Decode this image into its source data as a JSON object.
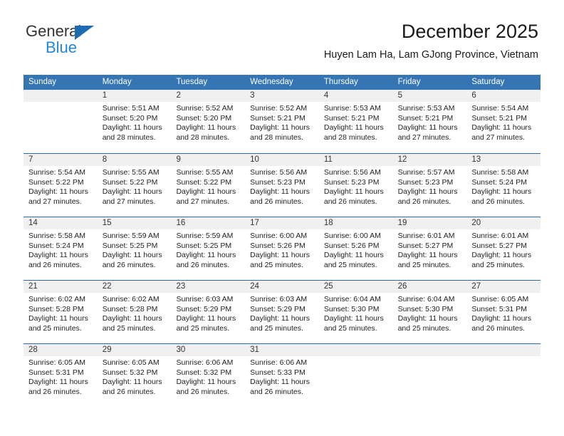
{
  "logo": {
    "word_top": "General",
    "word_bottom": "Blue",
    "triangle_icon": "triangle-icon",
    "colors": {
      "blue": "#2287d6",
      "triangle": "#1b6cb0",
      "dark": "#333333"
    }
  },
  "header": {
    "title": "December 2025",
    "subtitle": "Huyen Lam Ha, Lam GJong Province, Vietnam"
  },
  "theme": {
    "header_bar": "#3575b3",
    "row_divider": "#2f6aa8",
    "daynum_band": "#f0f0f0"
  },
  "weekdays": [
    "Sunday",
    "Monday",
    "Tuesday",
    "Wednesday",
    "Thursday",
    "Friday",
    "Saturday"
  ],
  "weeks": [
    {
      "days": [
        {
          "num": "",
          "lines": []
        },
        {
          "num": "1",
          "lines": [
            "Sunrise: 5:51 AM",
            "Sunset: 5:20 PM",
            "Daylight: 11 hours",
            "and 28 minutes."
          ]
        },
        {
          "num": "2",
          "lines": [
            "Sunrise: 5:52 AM",
            "Sunset: 5:20 PM",
            "Daylight: 11 hours",
            "and 28 minutes."
          ]
        },
        {
          "num": "3",
          "lines": [
            "Sunrise: 5:52 AM",
            "Sunset: 5:21 PM",
            "Daylight: 11 hours",
            "and 28 minutes."
          ]
        },
        {
          "num": "4",
          "lines": [
            "Sunrise: 5:53 AM",
            "Sunset: 5:21 PM",
            "Daylight: 11 hours",
            "and 28 minutes."
          ]
        },
        {
          "num": "5",
          "lines": [
            "Sunrise: 5:53 AM",
            "Sunset: 5:21 PM",
            "Daylight: 11 hours",
            "and 27 minutes."
          ]
        },
        {
          "num": "6",
          "lines": [
            "Sunrise: 5:54 AM",
            "Sunset: 5:21 PM",
            "Daylight: 11 hours",
            "and 27 minutes."
          ]
        }
      ]
    },
    {
      "days": [
        {
          "num": "7",
          "lines": [
            "Sunrise: 5:54 AM",
            "Sunset: 5:22 PM",
            "Daylight: 11 hours",
            "and 27 minutes."
          ]
        },
        {
          "num": "8",
          "lines": [
            "Sunrise: 5:55 AM",
            "Sunset: 5:22 PM",
            "Daylight: 11 hours",
            "and 27 minutes."
          ]
        },
        {
          "num": "9",
          "lines": [
            "Sunrise: 5:55 AM",
            "Sunset: 5:22 PM",
            "Daylight: 11 hours",
            "and 27 minutes."
          ]
        },
        {
          "num": "10",
          "lines": [
            "Sunrise: 5:56 AM",
            "Sunset: 5:23 PM",
            "Daylight: 11 hours",
            "and 26 minutes."
          ]
        },
        {
          "num": "11",
          "lines": [
            "Sunrise: 5:56 AM",
            "Sunset: 5:23 PM",
            "Daylight: 11 hours",
            "and 26 minutes."
          ]
        },
        {
          "num": "12",
          "lines": [
            "Sunrise: 5:57 AM",
            "Sunset: 5:23 PM",
            "Daylight: 11 hours",
            "and 26 minutes."
          ]
        },
        {
          "num": "13",
          "lines": [
            "Sunrise: 5:58 AM",
            "Sunset: 5:24 PM",
            "Daylight: 11 hours",
            "and 26 minutes."
          ]
        }
      ]
    },
    {
      "days": [
        {
          "num": "14",
          "lines": [
            "Sunrise: 5:58 AM",
            "Sunset: 5:24 PM",
            "Daylight: 11 hours",
            "and 26 minutes."
          ]
        },
        {
          "num": "15",
          "lines": [
            "Sunrise: 5:59 AM",
            "Sunset: 5:25 PM",
            "Daylight: 11 hours",
            "and 26 minutes."
          ]
        },
        {
          "num": "16",
          "lines": [
            "Sunrise: 5:59 AM",
            "Sunset: 5:25 PM",
            "Daylight: 11 hours",
            "and 26 minutes."
          ]
        },
        {
          "num": "17",
          "lines": [
            "Sunrise: 6:00 AM",
            "Sunset: 5:26 PM",
            "Daylight: 11 hours",
            "and 25 minutes."
          ]
        },
        {
          "num": "18",
          "lines": [
            "Sunrise: 6:00 AM",
            "Sunset: 5:26 PM",
            "Daylight: 11 hours",
            "and 25 minutes."
          ]
        },
        {
          "num": "19",
          "lines": [
            "Sunrise: 6:01 AM",
            "Sunset: 5:27 PM",
            "Daylight: 11 hours",
            "and 25 minutes."
          ]
        },
        {
          "num": "20",
          "lines": [
            "Sunrise: 6:01 AM",
            "Sunset: 5:27 PM",
            "Daylight: 11 hours",
            "and 25 minutes."
          ]
        }
      ]
    },
    {
      "days": [
        {
          "num": "21",
          "lines": [
            "Sunrise: 6:02 AM",
            "Sunset: 5:28 PM",
            "Daylight: 11 hours",
            "and 25 minutes."
          ]
        },
        {
          "num": "22",
          "lines": [
            "Sunrise: 6:02 AM",
            "Sunset: 5:28 PM",
            "Daylight: 11 hours",
            "and 25 minutes."
          ]
        },
        {
          "num": "23",
          "lines": [
            "Sunrise: 6:03 AM",
            "Sunset: 5:29 PM",
            "Daylight: 11 hours",
            "and 25 minutes."
          ]
        },
        {
          "num": "24",
          "lines": [
            "Sunrise: 6:03 AM",
            "Sunset: 5:29 PM",
            "Daylight: 11 hours",
            "and 25 minutes."
          ]
        },
        {
          "num": "25",
          "lines": [
            "Sunrise: 6:04 AM",
            "Sunset: 5:30 PM",
            "Daylight: 11 hours",
            "and 25 minutes."
          ]
        },
        {
          "num": "26",
          "lines": [
            "Sunrise: 6:04 AM",
            "Sunset: 5:30 PM",
            "Daylight: 11 hours",
            "and 25 minutes."
          ]
        },
        {
          "num": "27",
          "lines": [
            "Sunrise: 6:05 AM",
            "Sunset: 5:31 PM",
            "Daylight: 11 hours",
            "and 26 minutes."
          ]
        }
      ]
    },
    {
      "days": [
        {
          "num": "28",
          "lines": [
            "Sunrise: 6:05 AM",
            "Sunset: 5:31 PM",
            "Daylight: 11 hours",
            "and 26 minutes."
          ]
        },
        {
          "num": "29",
          "lines": [
            "Sunrise: 6:05 AM",
            "Sunset: 5:32 PM",
            "Daylight: 11 hours",
            "and 26 minutes."
          ]
        },
        {
          "num": "30",
          "lines": [
            "Sunrise: 6:06 AM",
            "Sunset: 5:32 PM",
            "Daylight: 11 hours",
            "and 26 minutes."
          ]
        },
        {
          "num": "31",
          "lines": [
            "Sunrise: 6:06 AM",
            "Sunset: 5:33 PM",
            "Daylight: 11 hours",
            "and 26 minutes."
          ]
        },
        {
          "num": "",
          "lines": []
        },
        {
          "num": "",
          "lines": []
        },
        {
          "num": "",
          "lines": []
        }
      ]
    }
  ]
}
